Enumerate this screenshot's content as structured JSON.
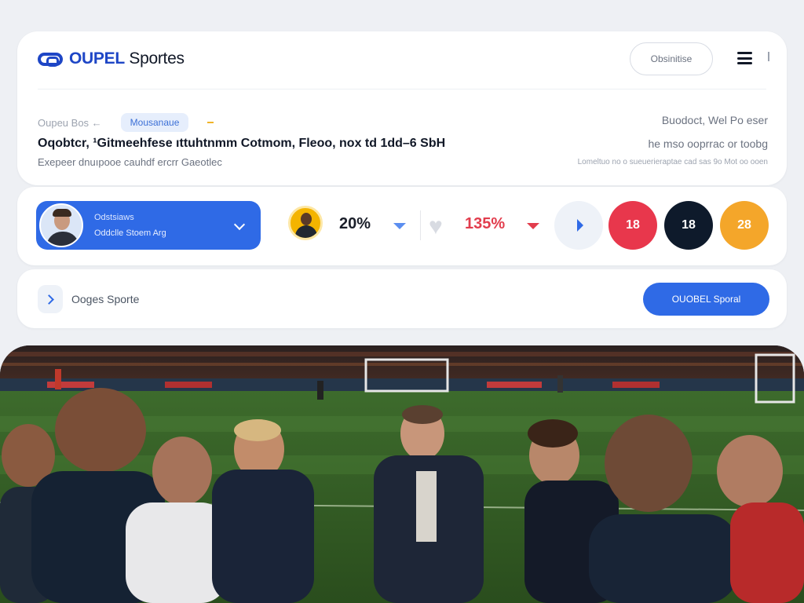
{
  "header": {
    "logo_brand": "OUPEL",
    "logo_rest": " Sportes",
    "nav_pill": "Obsinitise",
    "breadcrumb": "Oupeu Bos  ←",
    "tag": "Mousanaue",
    "headline": "Oqobtcr, ¹Gitmeehfese ıttuhtnmm  Cotmom,  Fleoo,  nox td 1dd–6 SbH",
    "subline": "Exepeer dnuıpooe cauhdf ercrr  Gaeotlec",
    "right_line1": "Buodoct,  Wel Po eser",
    "right_line2": "he mso ooprrac  or toobg",
    "right_line3": "Lomeltuo no o sueuerieraptae cad sas 9o Mot oo ooen"
  },
  "stats": {
    "profile_name": "Odstsiaws",
    "profile_sub": "Oddclle Stoem Arg",
    "pct_one": "20%",
    "pct_two": "135%",
    "score_red": "18",
    "score_navy": "18",
    "score_orange": "28"
  },
  "bar": {
    "label": "Ooges Sporte",
    "cta": "OUOBEL Sporal"
  },
  "colors": {
    "primary_blue": "#2f6ae6",
    "brand_blue": "#1e46c6",
    "red": "#e8374c",
    "navy": "#0e1a2b",
    "orange": "#f4a62a"
  },
  "icons": [
    "menu-icon",
    "chevron-down-icon",
    "heart-icon",
    "play-icon",
    "chevron-right-icon"
  ]
}
